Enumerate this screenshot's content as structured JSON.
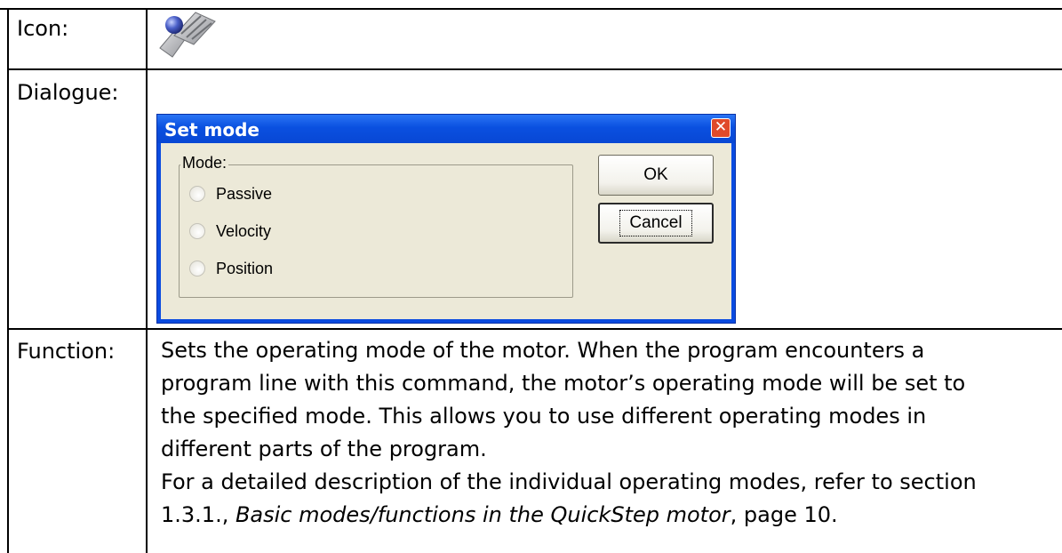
{
  "rows": {
    "icon": {
      "label": "Icon:",
      "icon_name": "set-mode-icon"
    },
    "dialogue": {
      "label": "Dialogue:"
    },
    "function": {
      "label": "Function:",
      "lines": [
        "Sets the operating mode of the motor. When the program encounters a",
        "program line with this command, the motor’s operating mode will be set to",
        "the specified mode. This allows you to use different operating modes in",
        "different parts of the program.",
        "For a detailed description of the individual operating modes, refer to section"
      ],
      "last_line": {
        "prefix": "1.3.1., ",
        "italic": "Basic modes/functions in the QuickStep motor",
        "suffix": ", page 10."
      }
    }
  },
  "dialog": {
    "title": "Set mode",
    "close_glyph": "✕",
    "group_label": "Mode:",
    "options": [
      "Passive",
      "Velocity",
      "Position"
    ],
    "ok_label": "OK",
    "cancel_label": "Cancel"
  },
  "colors": {
    "titlebar": "#0a50e0",
    "dialog_face": "#ece9d8",
    "close_button": "#e04a2a"
  }
}
